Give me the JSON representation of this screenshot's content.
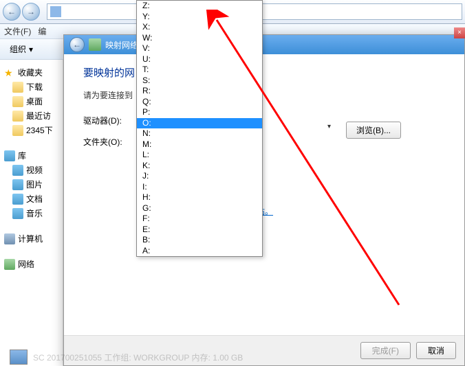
{
  "toolbar": {
    "file_menu": "文件(F)",
    "edit_menu": "编",
    "organize": "组织"
  },
  "sidebar": {
    "favorites": {
      "label": "收藏夹",
      "items": [
        "下载",
        "桌面",
        "最近访",
        "2345下"
      ]
    },
    "libraries": {
      "label": "库",
      "items": [
        "视频",
        "图片",
        "文档",
        "音乐"
      ]
    },
    "computer": "计算机",
    "network": "网络"
  },
  "dialog": {
    "title_prefix": "映射网络",
    "heading": "要映射的网",
    "instruction": "请为要连接到",
    "drive_label": "驱动器(D):",
    "folder_label": "文件夹(O):",
    "browse_label": "浏览(B)...",
    "link_fragment": "站。",
    "finish": "完成(F)",
    "cancel": "取消"
  },
  "dropdown": {
    "items": [
      "Z:",
      "Y:",
      "X:",
      "W:",
      "V:",
      "U:",
      "T:",
      "S:",
      "R:",
      "Q:",
      "P:",
      "O:",
      "N:",
      "M:",
      "L:",
      "K:",
      "J:",
      "I:",
      "H:",
      "G:",
      "F:",
      "E:",
      "B:",
      "A:"
    ],
    "selected": "O:"
  },
  "status": {
    "text": "SC 201700251055   工作组: WORKGROUP       内存: 1.00 GB"
  },
  "icons": {
    "back_glyph": "←",
    "fwd_glyph": "→",
    "chev_down": "▾",
    "computer_glyph": "🖥",
    "network_glyph": "🌐"
  }
}
